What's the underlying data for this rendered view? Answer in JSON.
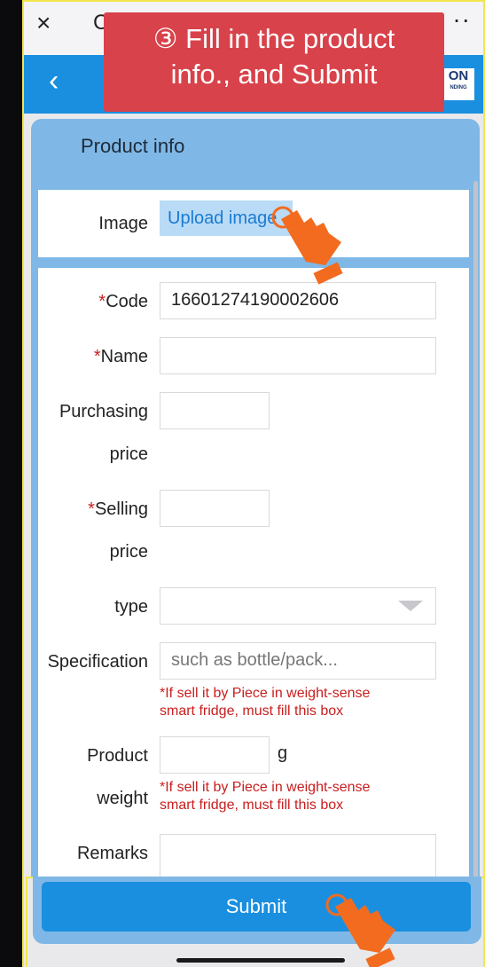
{
  "topbar": {
    "close_glyph": "×",
    "tab_glyph": "C",
    "more_glyph": "··"
  },
  "header": {
    "back_glyph": "‹",
    "logo_text": "ON",
    "logo_sub": "NDING"
  },
  "callout": {
    "line1": "③ Fill in the product",
    "line2": "info., and Submit"
  },
  "card": {
    "title": "Product info"
  },
  "image_row": {
    "label": "Image",
    "upload_label": "Upload image"
  },
  "form": {
    "code": {
      "label": "Code",
      "value": "16601274190002606"
    },
    "name": {
      "label": "Name",
      "value": ""
    },
    "purchasing_price": {
      "label_1": "Purchasing",
      "label_2": "price",
      "value": ""
    },
    "selling_price": {
      "label_1": "Selling",
      "label_2": "price",
      "value": ""
    },
    "type": {
      "label": "type",
      "value": ""
    },
    "specification": {
      "label": "Specification",
      "placeholder": "such as bottle/pack...",
      "hint_1": "*If sell it by Piece in weight-sense",
      "hint_2": "smart fridge, must fill this box"
    },
    "product_weight": {
      "label_1": "Product",
      "label_2": "weight",
      "unit": "g",
      "value": "",
      "hint_1": "*If sell it by Piece in weight-sense",
      "hint_2": "smart fridge, must fill this box"
    },
    "remarks": {
      "label": "Remarks",
      "value": ""
    },
    "required_mark": "*"
  },
  "submit": {
    "label": "Submit"
  },
  "colors": {
    "accent": "#1a8fe0",
    "callout": "#d8424a",
    "required": "#c81e1e",
    "highlight_border": "#f2e64a"
  }
}
